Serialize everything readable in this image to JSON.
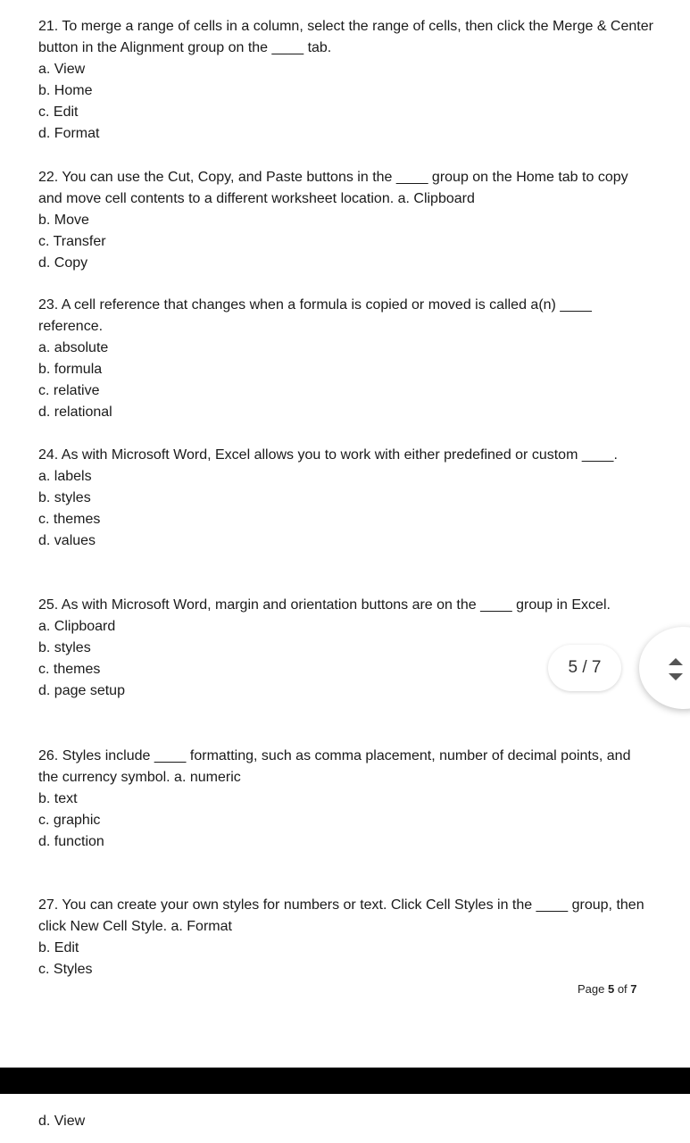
{
  "questions": [
    {
      "stem": "21. To merge a range of cells in a column, select the range of cells, then click the Merge & Center button in the Alignment group on the ____ tab.",
      "options": [
        "a. View",
        "b. Home",
        "c. Edit",
        "d. Format"
      ]
    },
    {
      "stem": "22. You can use the Cut, Copy, and Paste buttons in the ____ group on the Home tab to copy and move cell contents to a different worksheet location. a. Clipboard",
      "options": [
        "b. Move",
        "c. Transfer",
        "d. Copy"
      ]
    },
    {
      "stem": "23. A cell reference that changes when a formula is copied or moved is called a(n) ____ reference.",
      "options": [
        "a. absolute",
        "b. formula",
        "c. relative",
        "d. relational"
      ]
    },
    {
      "stem": "24. As with Microsoft Word, Excel allows you to work with either predefined or custom ____.",
      "options": [
        "a. labels",
        "b. styles",
        "c. themes",
        "d. values"
      ]
    },
    {
      "stem": "25. As with Microsoft Word, margin and orientation buttons are on the ____ group in Excel.",
      "options": [
        "a. Clipboard",
        "b. styles",
        "c. themes",
        "d. page setup"
      ]
    },
    {
      "stem": "26. Styles include ____ formatting, such as comma placement, number of decimal points, and the currency symbol. a. numeric",
      "options": [
        "b. text",
        "c. graphic",
        "d. function"
      ]
    },
    {
      "stem": "27. You can create your own styles for numbers or text. Click Cell Styles in the ____ group, then click New Cell Style. a. Format",
      "options": [
        "b. Edit",
        "c. Styles"
      ]
    }
  ],
  "footer": {
    "page_prefix": "Page ",
    "page_current": "5",
    "page_mid": " of ",
    "page_total": "7"
  },
  "next_page": {
    "option": "d. View"
  },
  "viewer": {
    "page_indicator": "5 / 7",
    "scroll_icon": "up-down-arrows-icon"
  }
}
